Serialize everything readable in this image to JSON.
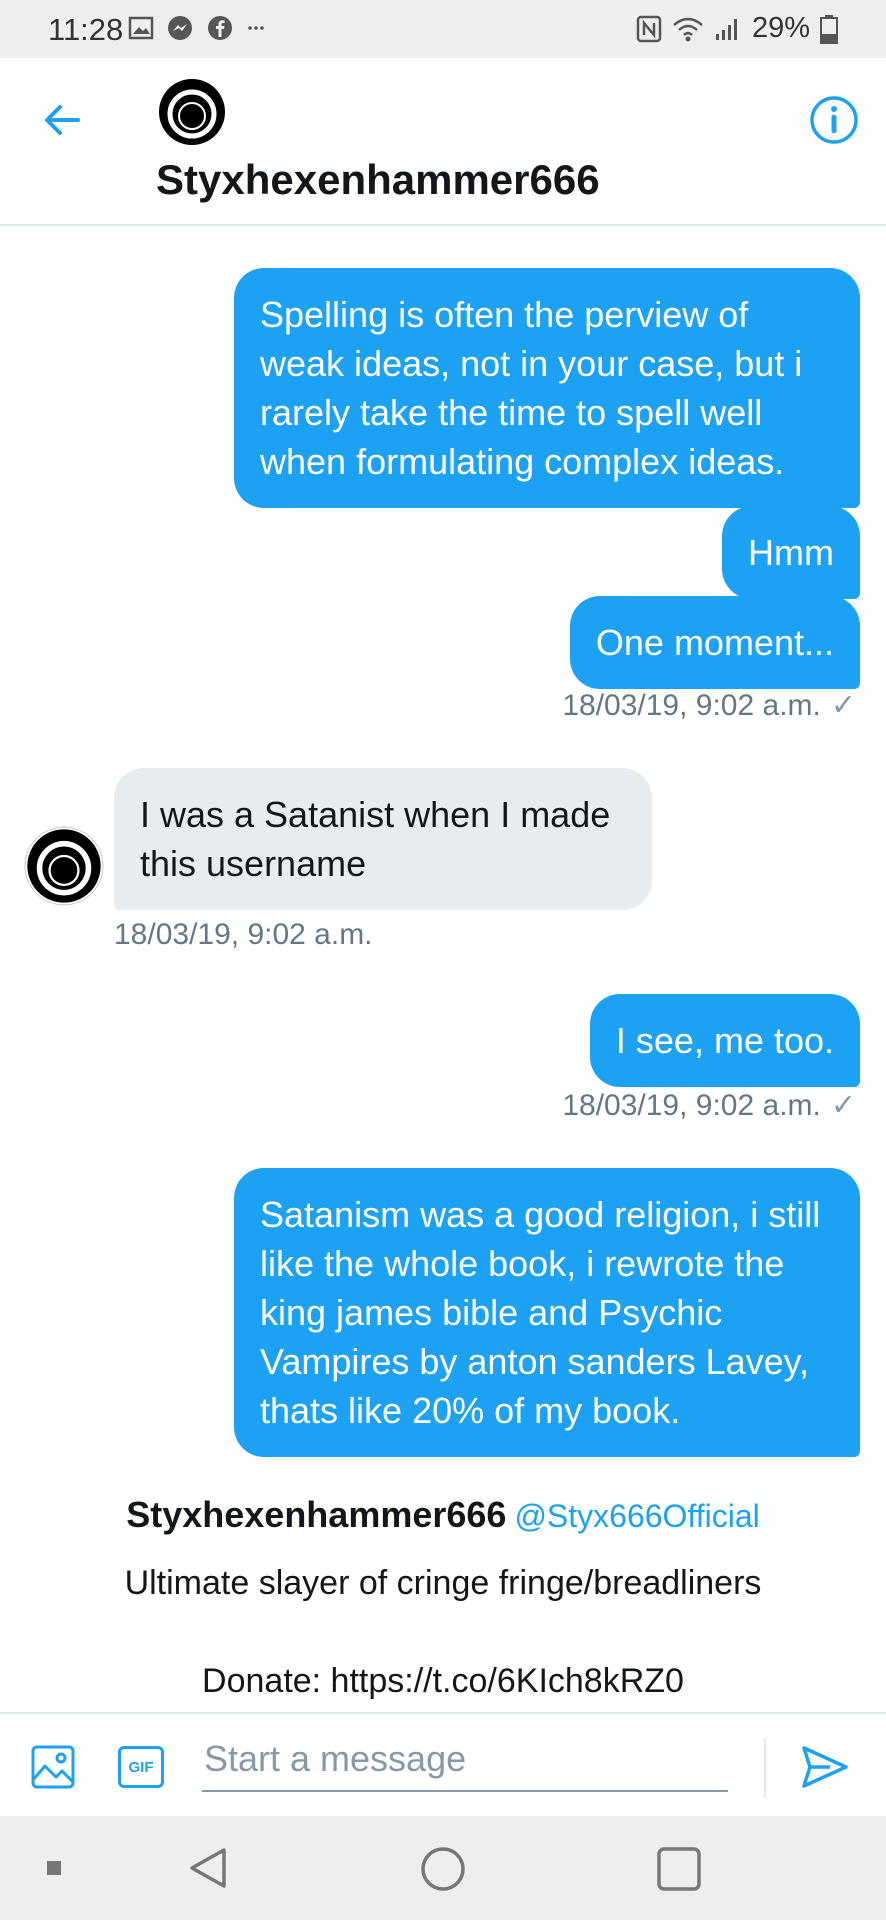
{
  "status_bar": {
    "time": "11:28",
    "battery": "29%"
  },
  "header": {
    "title": "Styxhexenhammer666"
  },
  "messages": [
    {
      "text": "Spelling is often the perview of weak ideas, not in your case, but i rarely take the time to spell well when formulating complex ideas.",
      "direction": "sent"
    },
    {
      "text": "Hmm",
      "direction": "sent"
    },
    {
      "text": "One moment...",
      "direction": "sent",
      "timestamp": "18/03/19, 9:02 a.m."
    },
    {
      "text": "I was a Satanist when I made this username",
      "direction": "received",
      "timestamp": "18/03/19, 9:02 a.m."
    },
    {
      "text": "I see, me too.",
      "direction": "sent",
      "timestamp": "18/03/19, 9:02 a.m."
    },
    {
      "text": "Satanism was a good religion, i still like the whole book, i rewrote the king james bible and Psychic Vampires by anton sanders Lavey, thats like 20% of my book.",
      "direction": "sent"
    }
  ],
  "check_mark": "✓",
  "profile": {
    "name": "Styxhexenhammer666",
    "handle": "@Styx666Official",
    "bio": "Ultimate slayer of cringe fringe/breadliners",
    "donate": "Donate: https://t.co/6KIch8kRZ0"
  },
  "composer": {
    "placeholder": "Start a message",
    "gif_label": "GIF"
  },
  "colors": {
    "accent": "#1da1f2",
    "received_bubble": "#e6ecf0"
  }
}
